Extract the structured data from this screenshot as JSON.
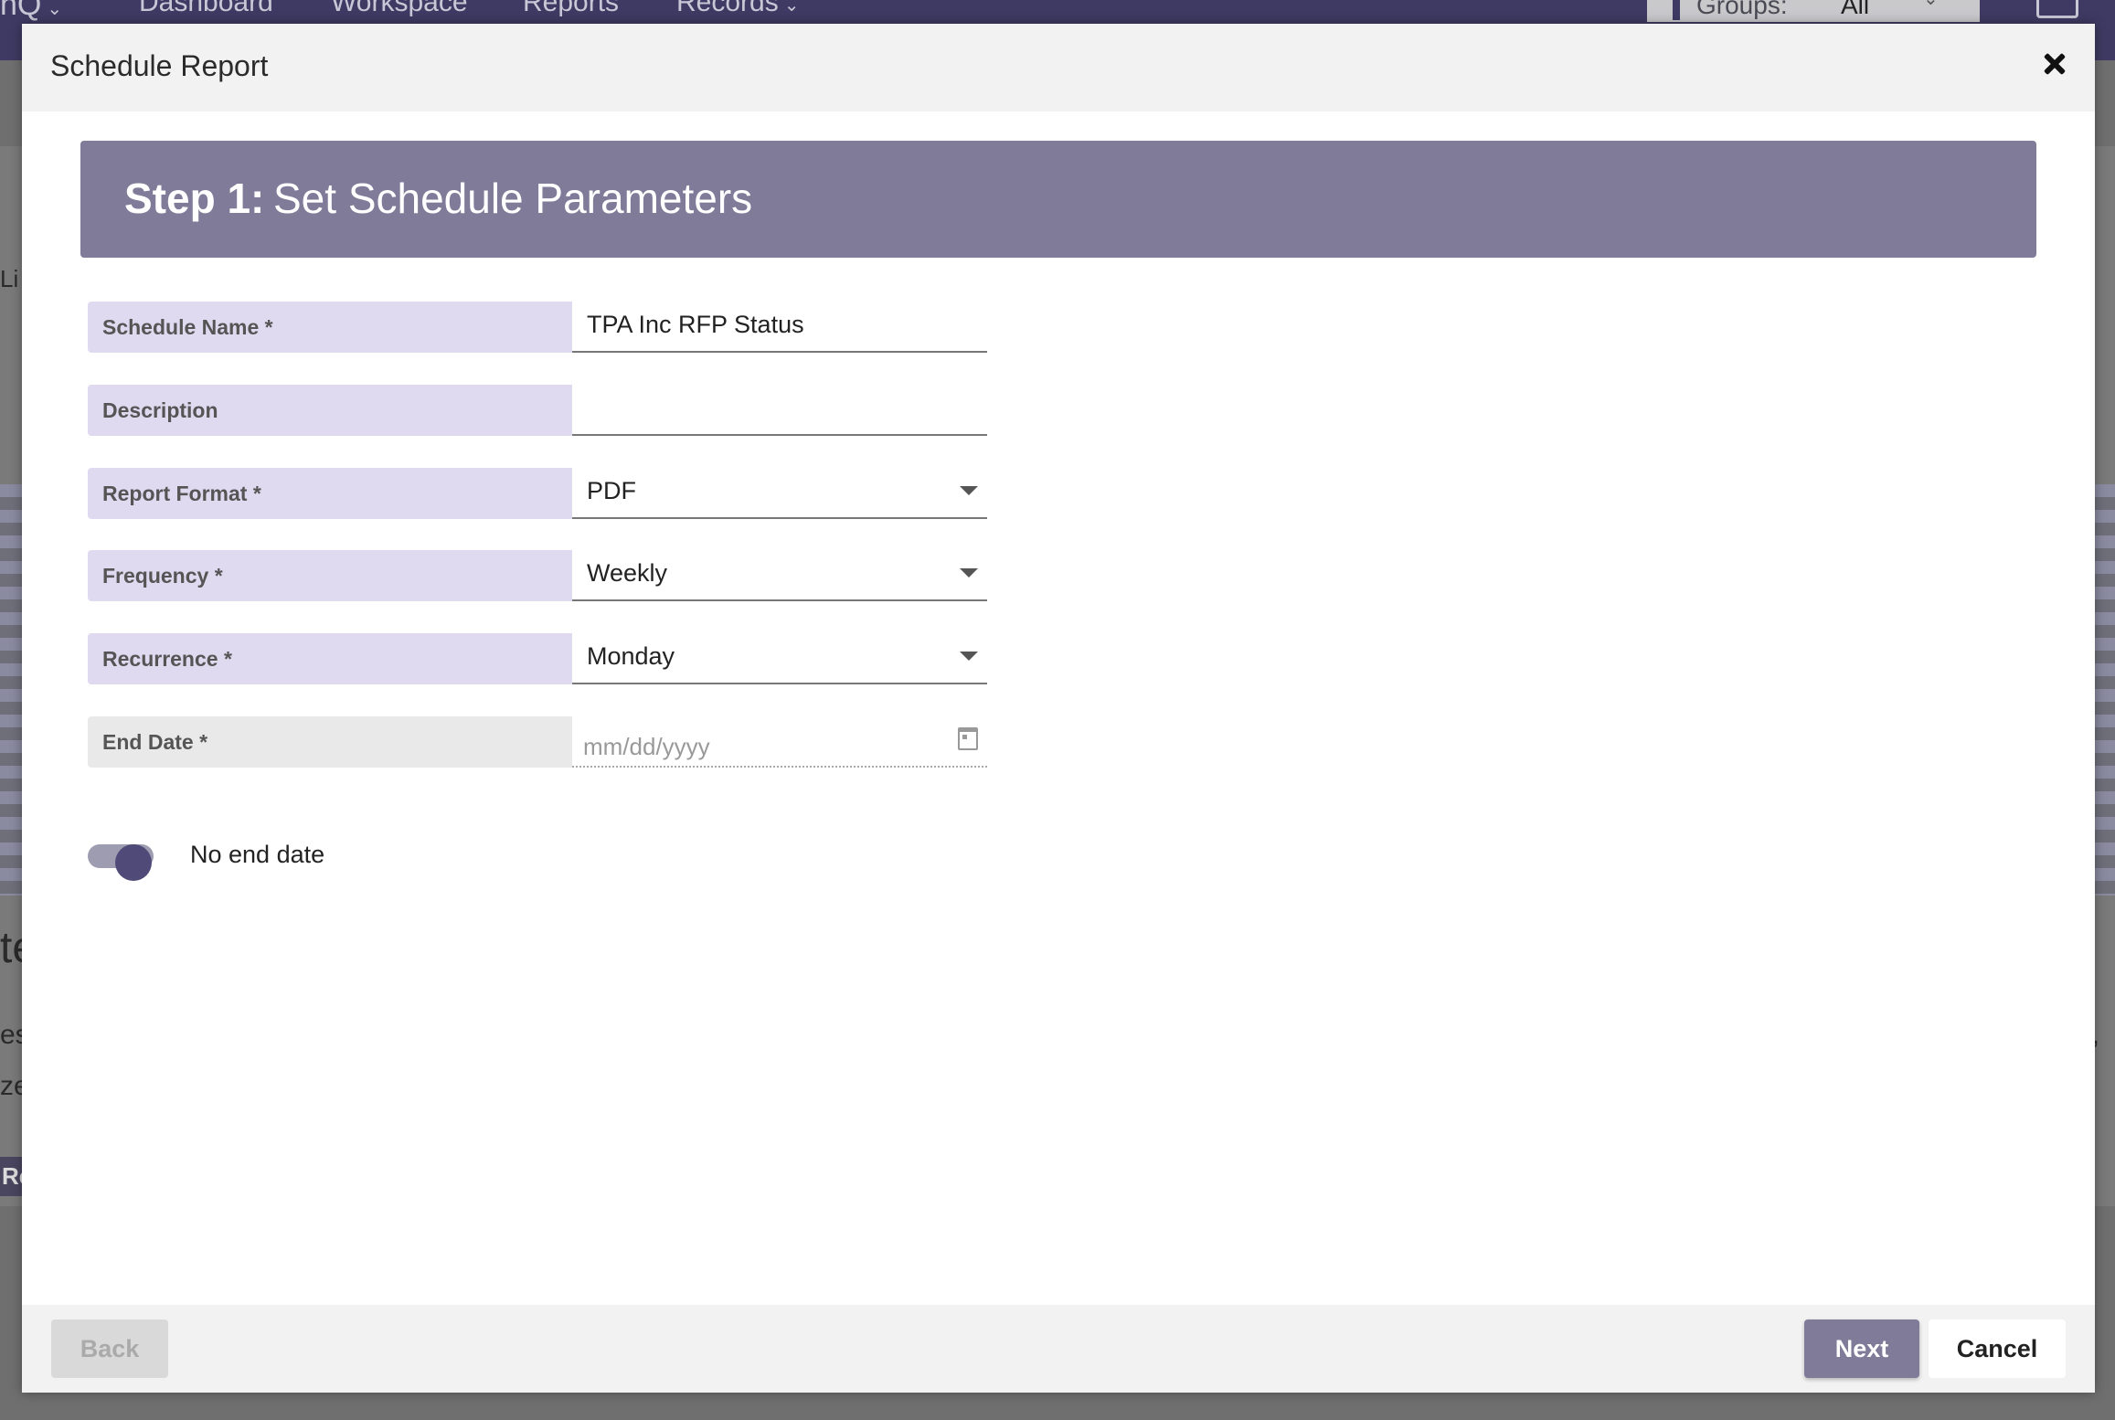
{
  "background_app": {
    "brand": "nQ",
    "nav": [
      "Dashboard",
      "Workspace",
      "Reports",
      "Records"
    ],
    "groups_label": "Groups:",
    "groups_value": "All",
    "left_fragments": [
      "Li",
      "te",
      "es",
      "ze",
      "Re"
    ],
    "right_fragments": [
      "e,"
    ]
  },
  "modal": {
    "title": "Schedule Report",
    "step": {
      "label": "Step 1:",
      "text": "Set Schedule Parameters"
    },
    "fields": {
      "schedule_name": {
        "label": "Schedule Name *",
        "value": "TPA Inc RFP Status"
      },
      "description": {
        "label": "Description",
        "value": ""
      },
      "report_format": {
        "label": "Report Format *",
        "value": "PDF"
      },
      "frequency": {
        "label": "Frequency *",
        "value": "Weekly"
      },
      "recurrence": {
        "label": "Recurrence *",
        "value": "Monday"
      },
      "end_date": {
        "label": "End Date *",
        "placeholder": "mm/dd/yyyy"
      }
    },
    "toggle": {
      "label": "No end date",
      "on": true
    },
    "footer": {
      "back_label": "Back",
      "next_label": "Next",
      "cancel_label": "Cancel"
    }
  },
  "colors": {
    "nav_bg": "#3e3a63",
    "banner_bg": "#7f7b99",
    "label_bg": "#e0daf0",
    "toggle_knob": "#4f4a77"
  }
}
